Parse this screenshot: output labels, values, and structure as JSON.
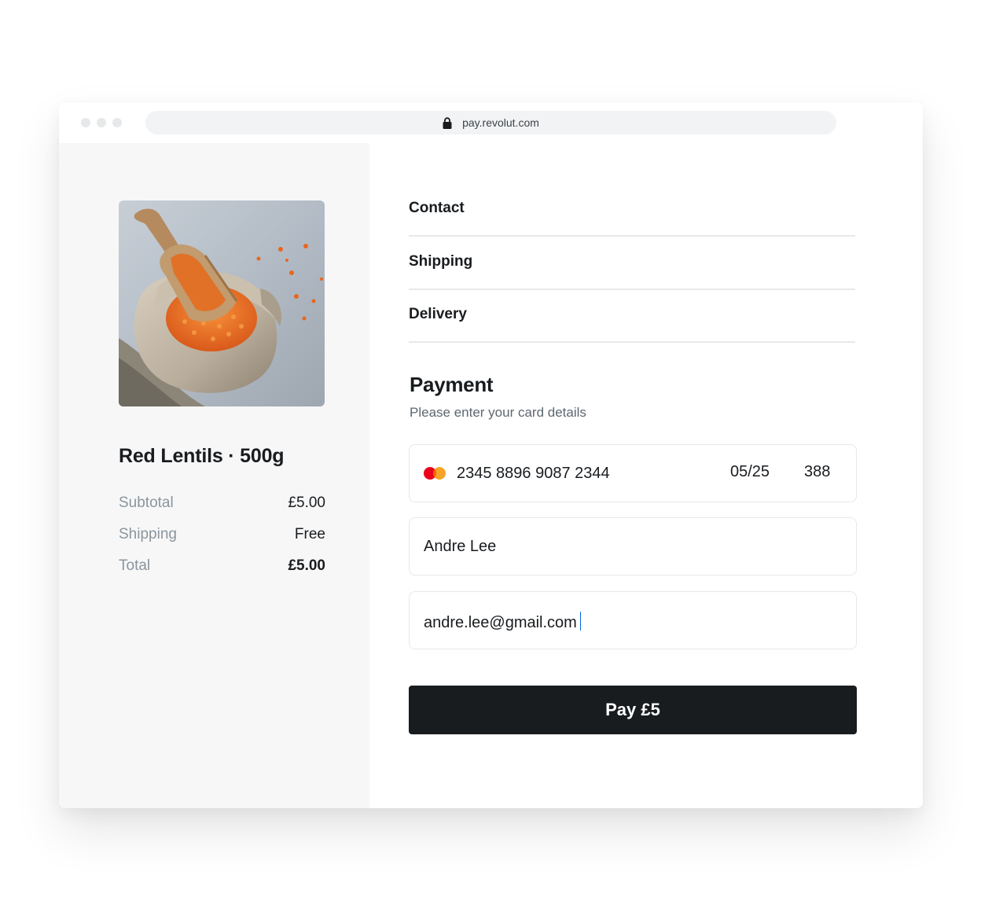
{
  "browser": {
    "url": "pay.revolut.com"
  },
  "product": {
    "name": "Red Lentils · 500g",
    "image_alt": "Red lentils in a burlap sack with a wooden scoop"
  },
  "summary": {
    "subtotal_label": "Subtotal",
    "subtotal_value": "£5.00",
    "shipping_label": "Shipping",
    "shipping_value": "Free",
    "total_label": "Total",
    "total_value": "£5.00"
  },
  "checkout": {
    "sections": [
      {
        "label": "Contact"
      },
      {
        "label": "Shipping"
      },
      {
        "label": "Delivery"
      }
    ],
    "payment_title": "Payment",
    "payment_subtitle": "Please enter your card details",
    "card": {
      "number": "2345 8896 9087 2344",
      "expiry": "05/25",
      "cvv": "388",
      "brand_icon": "mastercard-icon"
    },
    "name_value": "Andre Lee",
    "email_value": "andre.lee@gmail.com",
    "pay_button_label": "Pay £5"
  },
  "colors": {
    "button_bg": "#191c1f",
    "left_panel_bg": "#f7f7f7",
    "caret": "#0666eb",
    "mastercard_red": "#eb001b",
    "mastercard_orange": "#f79e1b"
  }
}
